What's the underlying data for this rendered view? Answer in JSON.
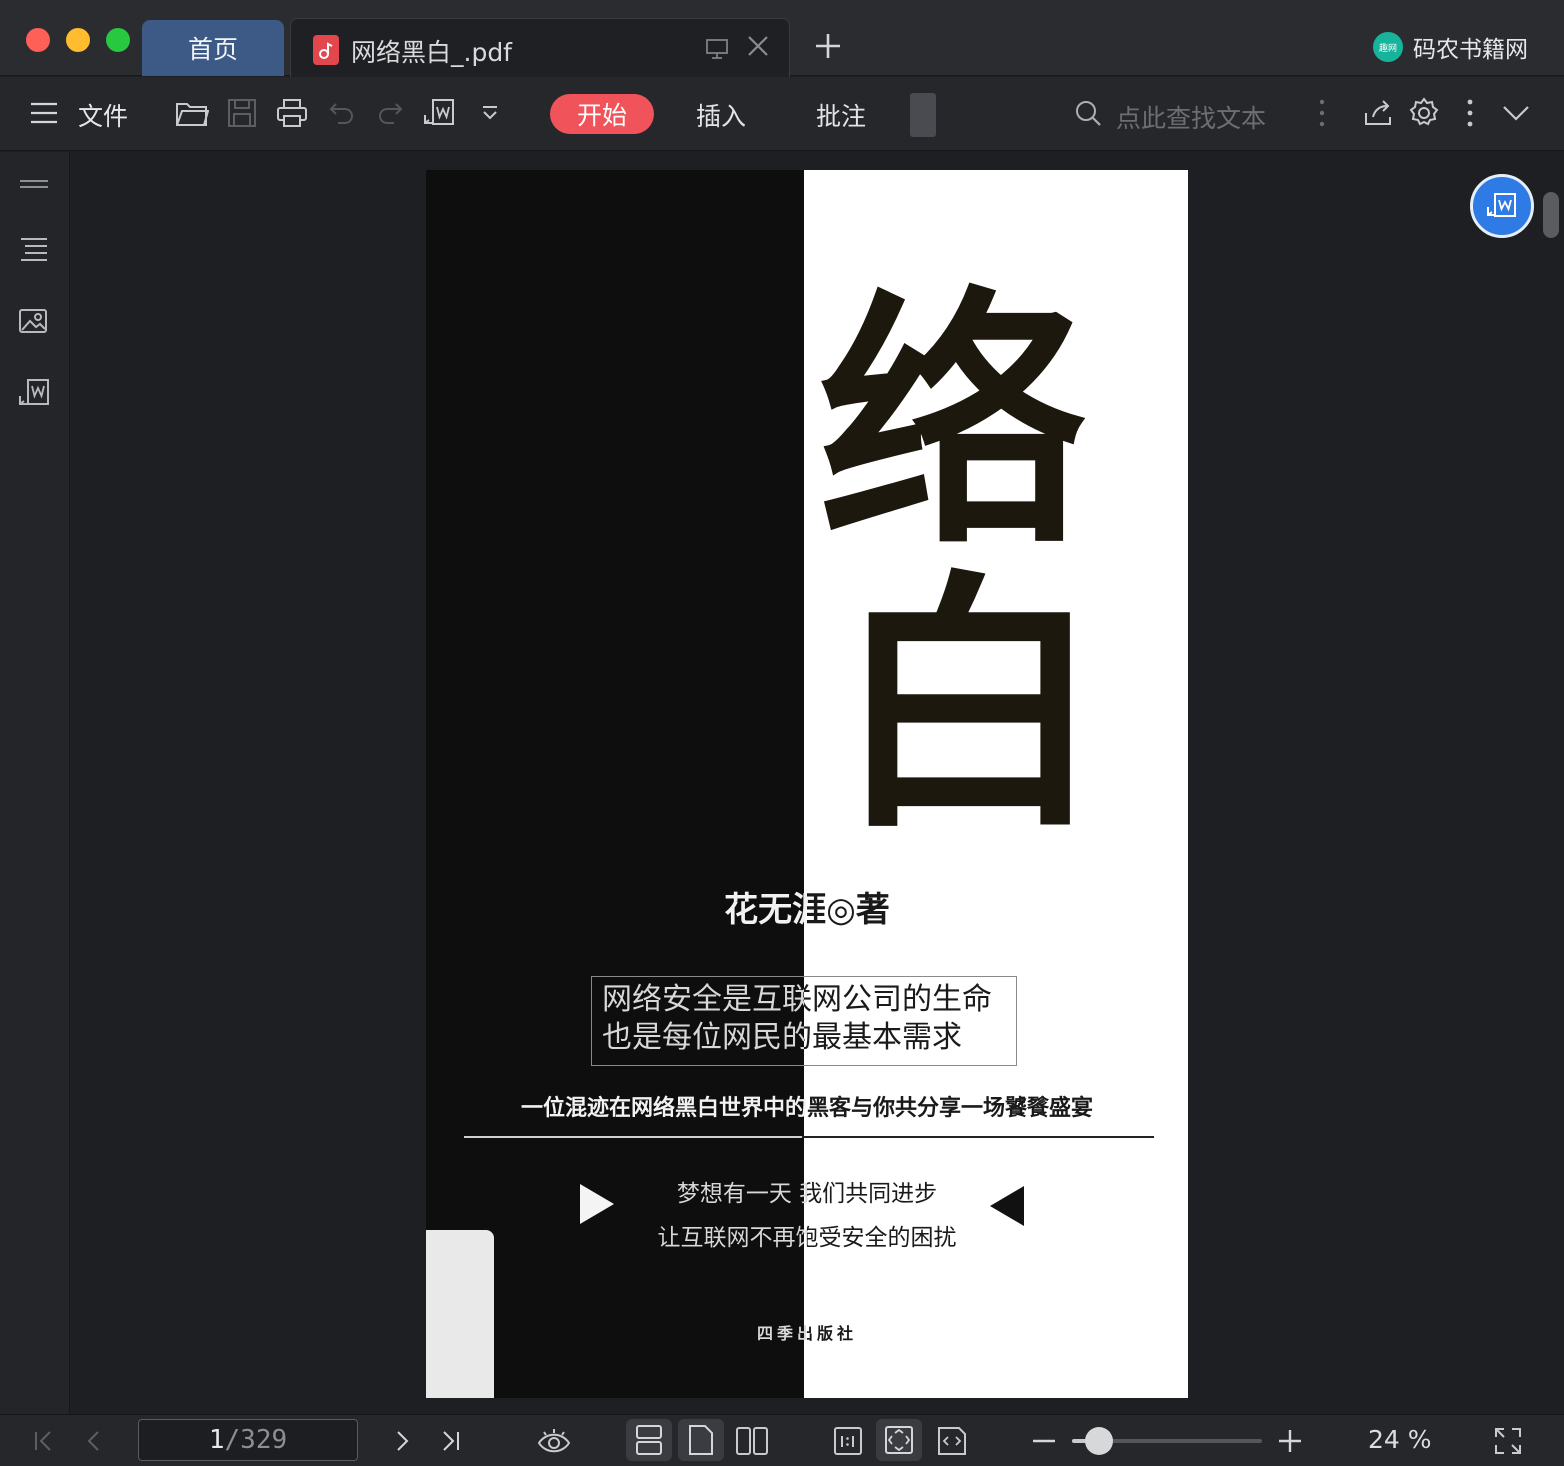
{
  "window": {
    "colors": {
      "close": "#fe5f57",
      "minimize": "#febc2e",
      "maximize": "#28c840",
      "accent": "#f0545a",
      "home_tab": "#3c5a85",
      "fab": "#2f7be5"
    }
  },
  "tabs": {
    "home_label": "首页",
    "doc_title": "网络黑白_.pdf",
    "doc_icon": "pdf-file-icon",
    "new_tab_icon": "plus-icon"
  },
  "brand": {
    "logo_text": "趣网",
    "name": "码农书籍网"
  },
  "toolbar": {
    "file_label": "文件",
    "ribbon_tabs": [
      "开始",
      "插入",
      "批注"
    ],
    "active_tab": "开始",
    "search_placeholder": "点此查找文本",
    "icons": [
      "hamburger-icon",
      "open-folder-icon",
      "save-icon",
      "print-icon",
      "undo-icon",
      "redo-icon",
      "pdf-to-word-icon",
      "dropdown-icon",
      "search-icon",
      "more-vertical-icon",
      "share-icon",
      "settings-icon",
      "more-vertical-icon",
      "collapse-chevron-icon"
    ]
  },
  "rail": {
    "icons": [
      "thumbnail-panel-icon",
      "outline-icon",
      "image-icon",
      "convert-icon"
    ]
  },
  "document": {
    "cover": {
      "title_chars": [
        "络",
        "白"
      ],
      "author": "花无涯◎著",
      "quote_line1": "网络安全是互联网公司的生命",
      "quote_line2": "也是每位网民的最基本需求",
      "tagline": "一位混迹在网络黑白世界中的黑客与你共分享一场饕餮盛宴",
      "dream_line1": "梦想有一天 我们共同进步",
      "dream_line2": "让互联网不再饱受安全的困扰",
      "publisher": "四季出版社"
    }
  },
  "statusbar": {
    "current_page": "1",
    "total_pages": "/329",
    "zoom_percent": 24,
    "zoom_label": "24 %"
  }
}
